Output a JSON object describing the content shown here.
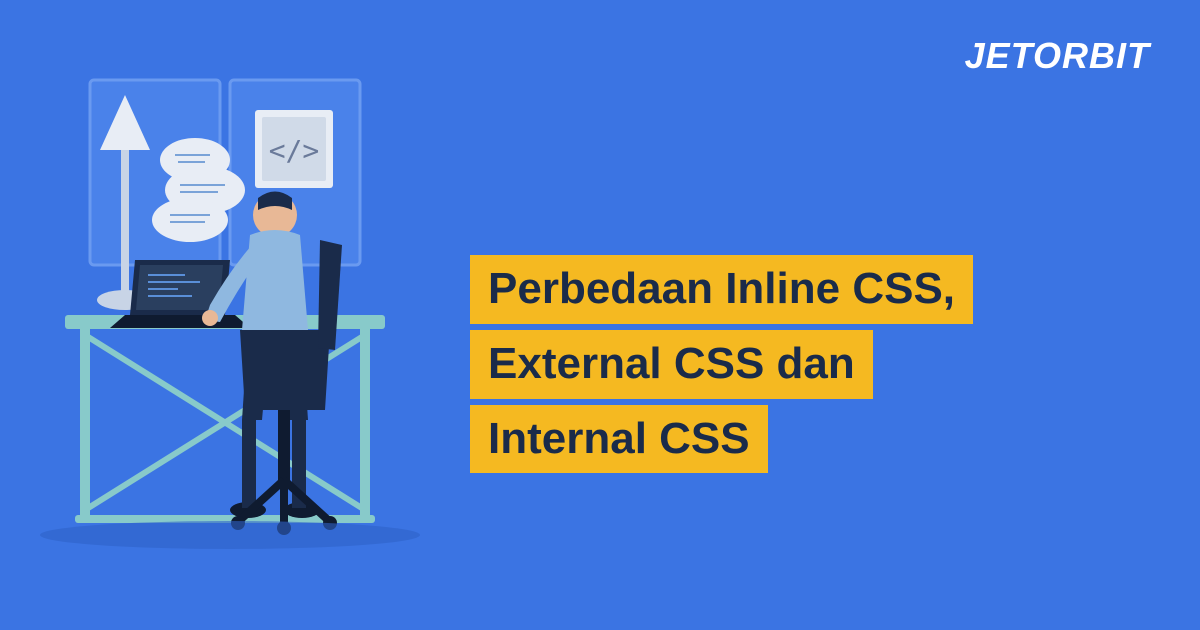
{
  "logo": "JETORBIT",
  "title": {
    "line1": "Perbedaan Inline CSS,",
    "line2": "External CSS dan",
    "line3": "Internal CSS"
  },
  "colors": {
    "background": "#3b74e3",
    "highlight": "#f5b921",
    "titleText": "#1a2b4a",
    "logoText": "#ffffff"
  }
}
